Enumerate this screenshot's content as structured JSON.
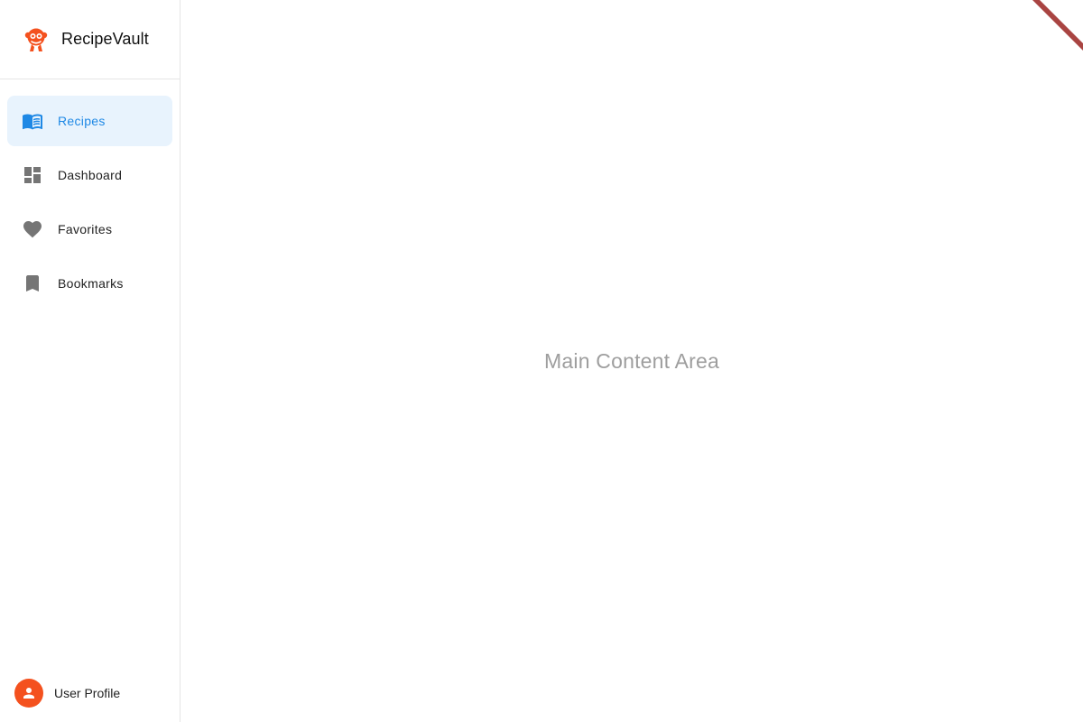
{
  "app": {
    "name": "RecipeVault"
  },
  "sidebar": {
    "items": [
      {
        "label": "Recipes",
        "icon": "menu-book-icon",
        "active": true
      },
      {
        "label": "Dashboard",
        "icon": "dashboard-icon",
        "active": false
      },
      {
        "label": "Favorites",
        "icon": "heart-icon",
        "active": false
      },
      {
        "label": "Bookmarks",
        "icon": "bookmark-icon",
        "active": false
      }
    ],
    "profile": {
      "label": "User Profile",
      "icon": "person-icon"
    }
  },
  "main": {
    "placeholder": "Main Content Area"
  },
  "colors": {
    "accent": "#1e88e5",
    "active_bg": "#e8f3fd",
    "brand": "#f4511e",
    "icon_gray": "#757575",
    "ribbon": "#a94442"
  }
}
